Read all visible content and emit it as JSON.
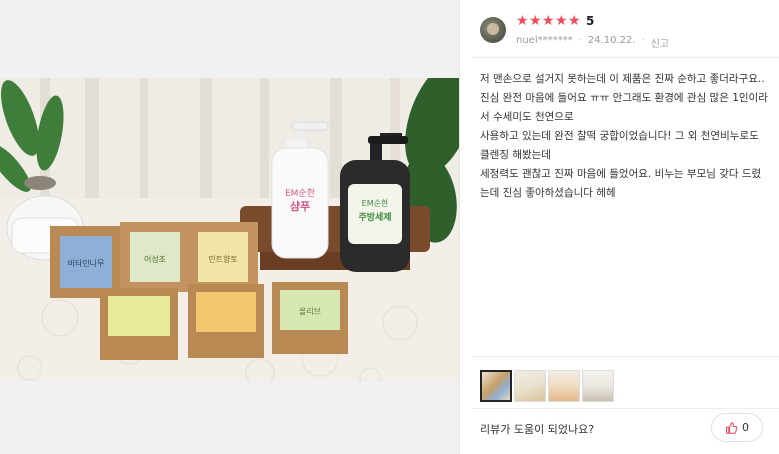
{
  "review": {
    "rating": "5",
    "stars": [
      "★",
      "★",
      "★",
      "★",
      "★"
    ],
    "reviewer": "nuel*******",
    "date": "24.10.22.",
    "report_label": "신고",
    "body": [
      "저 맨손으로 설거지 못하는데 이 제품은 진짜 순하고 좋더라구요..",
      "진심 완전 마음에 들어요 ㅠㅠ 안그래도 환경에 관심 많은 1인이라서 수세미도 천연으로",
      "사용하고 있는데 완전 찰떡 궁합이었습니다! 그 외 천연비누로도 클렌징 해봤는데",
      "세정력도 괜찮고 진짜 마음에 들었어요. 비누는 부모님 갖다 드렸는데 진심 좋아하셨습니다 헤헤"
    ],
    "helpful_question": "리뷰가 도움이 되었나요?",
    "like_count": "0"
  },
  "photo": {
    "bottle_left_label": "EM순한 샴푸",
    "bottle_right_label": "EM순한 주방세제",
    "soap_labels": [
      "비타민나무",
      "어성초",
      "민트향토",
      "",
      "",
      "올리브"
    ]
  },
  "thumbnails": [
    {
      "name": "thumb-1",
      "active": true
    },
    {
      "name": "thumb-2",
      "active": false
    },
    {
      "name": "thumb-3",
      "active": false
    },
    {
      "name": "thumb-4",
      "active": false
    }
  ],
  "colors": {
    "star": "#f4495a",
    "divider": "#e5e5e5",
    "meta_text": "#9a9a9a"
  },
  "icons": {
    "like": "thumbs-up-icon"
  }
}
